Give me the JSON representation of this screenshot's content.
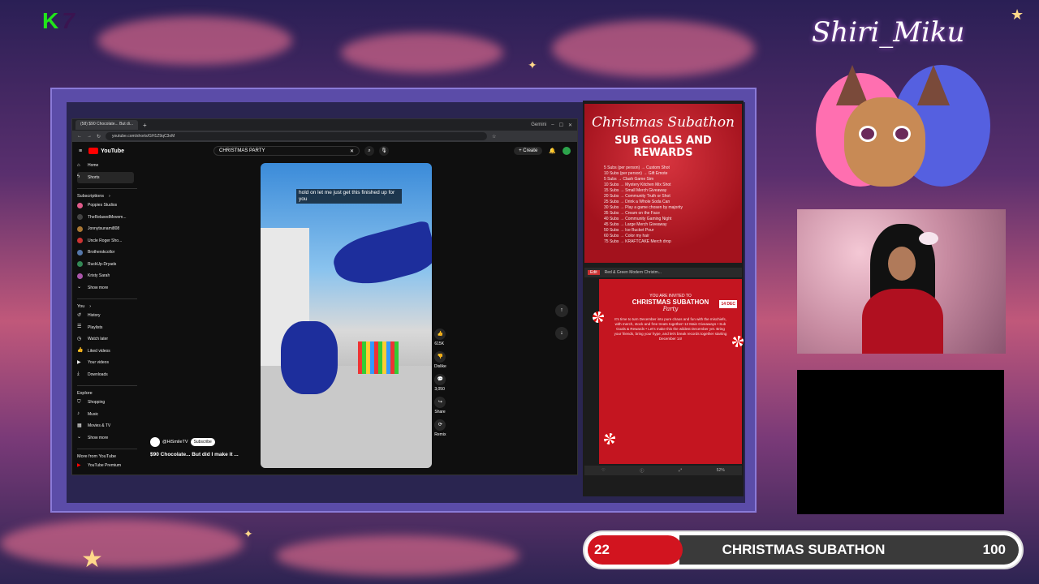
{
  "overlay": {
    "logo_letter": "K",
    "logo_number": "7",
    "streamer_name": "Shiri_Miku"
  },
  "browser": {
    "tabs": [
      {
        "title": "(58) $90 Chocolate... But di..."
      }
    ],
    "profile_label": "Gemini",
    "url": "youtube.com/shorts/GH1Z9qC3oM",
    "youtube": {
      "logo_text": "YouTube",
      "search_value": "CHRISTMAS PARTY",
      "create_label": "Create",
      "sidebar": {
        "primary": [
          {
            "label": "Home",
            "icon": "home-icon"
          },
          {
            "label": "Shorts",
            "icon": "shorts-icon",
            "active": true
          }
        ],
        "subscriptions_header": "Subscriptions",
        "subscriptions": [
          {
            "label": "Poppies Studios",
            "color": "#e05a8a"
          },
          {
            "label": "TheRelaxedMovem...",
            "color": "#444444"
          },
          {
            "label": "Jonnytsunami808",
            "color": "#aa7733"
          },
          {
            "label": "Uncle Roger Sho...",
            "color": "#cc3333"
          },
          {
            "label": "Brotherskcollor",
            "color": "#5577aa"
          },
          {
            "label": "RuckUp-Dryads",
            "color": "#338855"
          },
          {
            "label": "Kristy Sarah",
            "color": "#aa55aa"
          }
        ],
        "show_more_1": "Show more",
        "you_header": "You",
        "you_items": [
          {
            "label": "History",
            "icon": "history-icon"
          },
          {
            "label": "Playlists",
            "icon": "playlist-icon"
          },
          {
            "label": "Watch later",
            "icon": "clock-icon"
          },
          {
            "label": "Liked videos",
            "icon": "thumbs-up-icon"
          },
          {
            "label": "Your videos",
            "icon": "video-icon"
          },
          {
            "label": "Downloads",
            "icon": "download-icon"
          }
        ],
        "explore_header": "Explore",
        "explore_items": [
          {
            "label": "Shopping",
            "icon": "bag-icon"
          },
          {
            "label": "Music",
            "icon": "music-icon"
          },
          {
            "label": "Movies & TV",
            "icon": "film-icon"
          }
        ],
        "show_more_2": "Show more",
        "more_header": "More from YouTube",
        "more_items": [
          {
            "label": "YouTube Premium",
            "icon": "youtube-premium-icon"
          }
        ]
      },
      "short": {
        "caption": "hold on let me just get this finished up for you",
        "channel": "@HiSmileTV",
        "subscribe_label": "Subscribe",
        "title": "$90 Chocolate... But did I make it ...",
        "likes": "615K",
        "dislike_label": "Dislike",
        "comments": "3,050",
        "share_label": "Share",
        "remix_label": "Remix"
      }
    }
  },
  "flyers": {
    "goals_script": "Christmas Subathon",
    "goals_title": "SUB GOALS AND REWARDS",
    "goals_list": [
      "5 Subs (per person) → Custom Shot",
      "10 Subs (per person) → Gift Emote",
      "5 Subs → Clash Game Sim",
      "10 Subs → Mystery Kitchen Mix Shot",
      "15 Subs → Small Merch Giveaway",
      "20 Subs → Community Truth or Shot",
      "25 Subs → Drink a Whole Soda Can",
      "30 Subs → Play a game chosen by majority",
      "35 Subs → Cream on the Face",
      "40 Subs → Community Gaming Night",
      "45 Subs → Large Merch Giveaway",
      "50 Subs → Ice Bucket Pour",
      "60 Subs → Color my hair",
      "75 Subs → KRAFTCAKE Merch drop"
    ],
    "pdf_tab": "Edit",
    "pdf_title": "Red & Green Modern Christm...",
    "invite_pre": "YOU ARE INVITED TO",
    "invite_head": "CHRISTMAS SUBATHON",
    "invite_party": "Party",
    "invite_date": "14 DEC",
    "invite_body": "It's time to turn December into pure chaos and fun with the mischiefs, with merch, stock and free treats together! 12 Main Giveaways • Sub Goals & Rewards • Let's make this the wildest December yet. Bring your friends, bring your hype, and let's break records together starting December 14!",
    "zoom": "52%"
  },
  "subathon": {
    "title": "CHRISTMAS SUBATHON",
    "current": "22",
    "goal": "100",
    "progress_fraction": 0.22,
    "colors": {
      "fill": "#d2141f",
      "track": "#3a3a3a",
      "border": "#ffffff"
    }
  }
}
